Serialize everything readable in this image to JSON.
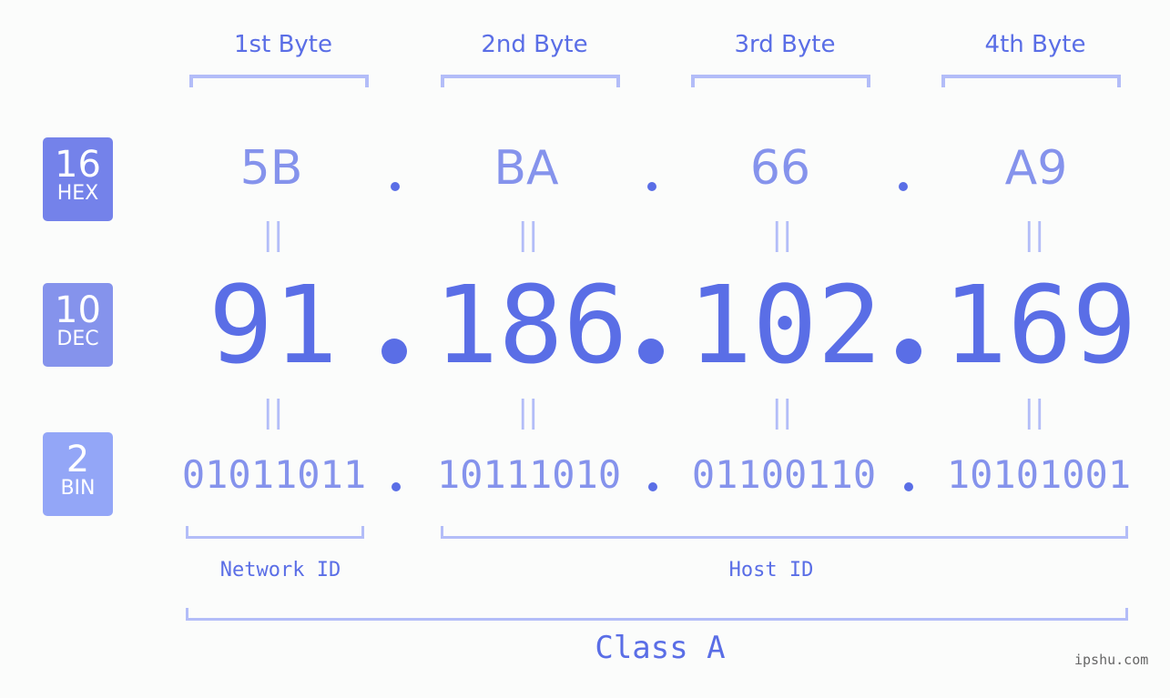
{
  "badges": [
    {
      "number": "16",
      "label": "HEX",
      "color": "#7482ea"
    },
    {
      "number": "10",
      "label": "DEC",
      "color": "#8593ec"
    },
    {
      "number": "2",
      "label": "BIN",
      "color": "#93a6f7"
    }
  ],
  "byte_titles": [
    "1st Byte",
    "2nd Byte",
    "3rd Byte",
    "4th Byte"
  ],
  "hex": [
    "5B",
    "BA",
    "66",
    "A9"
  ],
  "dec": [
    "91",
    "186",
    "102",
    "169"
  ],
  "bin": [
    "01011011",
    "10111010",
    "01100110",
    "10101001"
  ],
  "equals_symbol": "||",
  "network_label": "Network ID",
  "host_label": "Host ID",
  "class_label": "Class A",
  "watermark": "ipshu.com",
  "colors": {
    "primary": "#5a6ee6",
    "secondary": "#8593ec",
    "bracket": "#b3bdf8",
    "background": "#fbfcfb"
  }
}
